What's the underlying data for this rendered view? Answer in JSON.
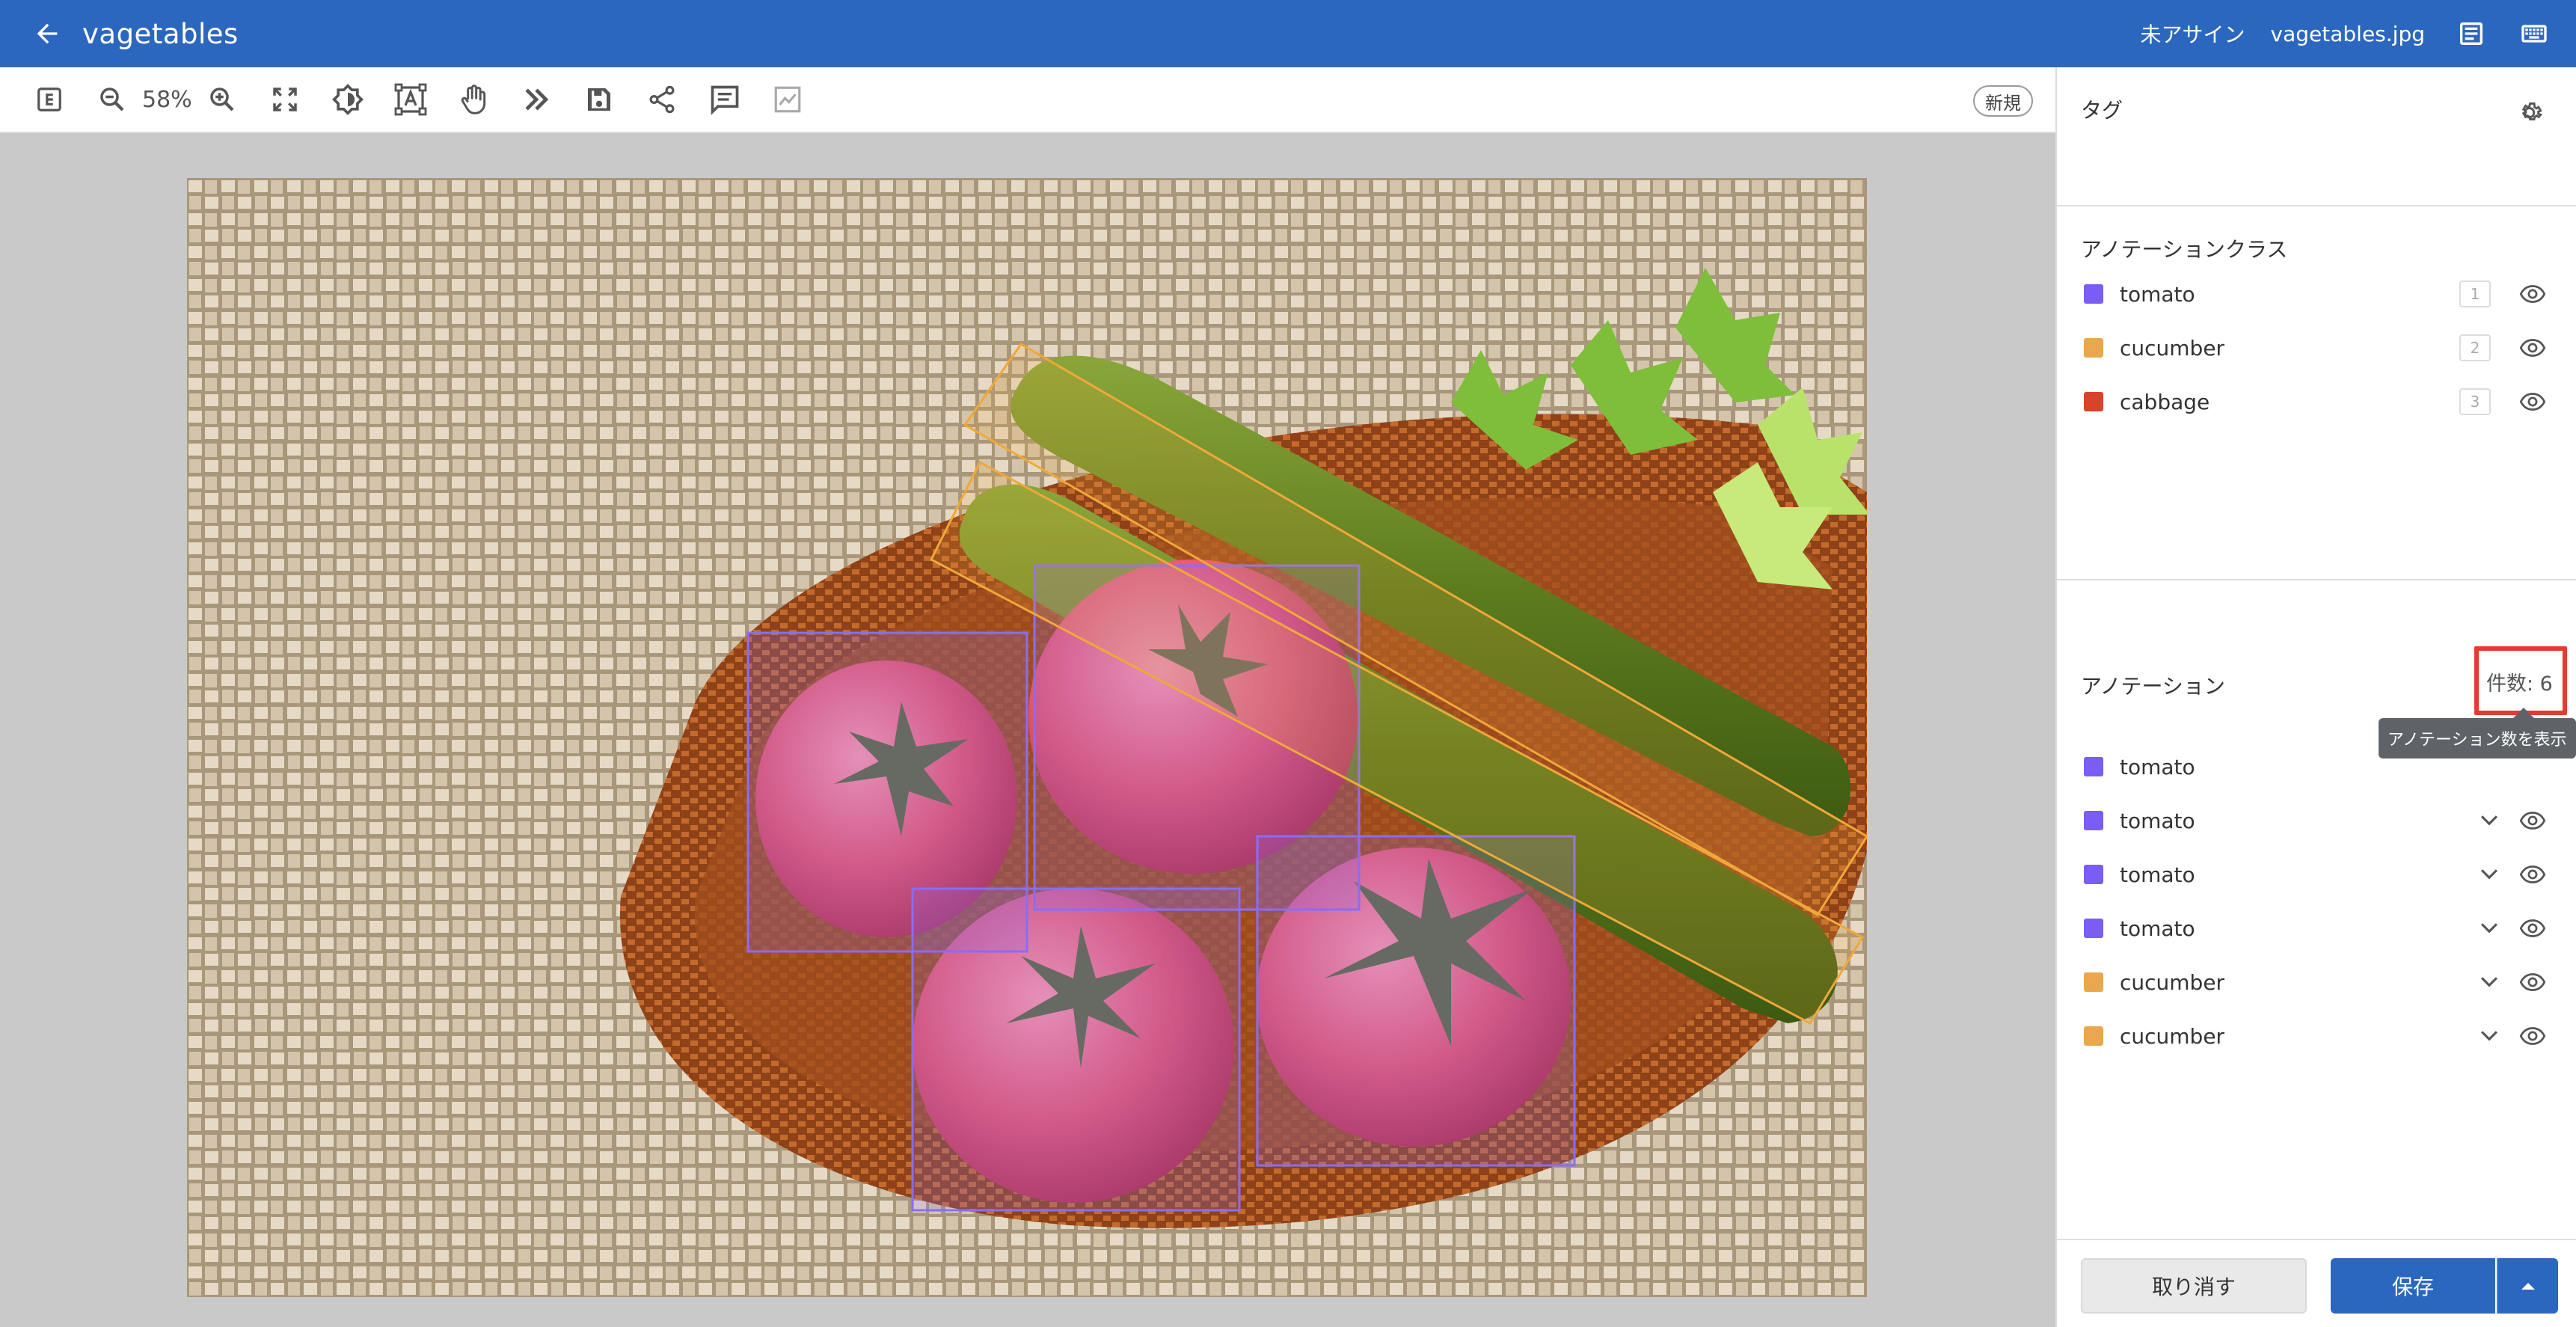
{
  "header": {
    "title": "vagetables",
    "assignee": "未アサイン",
    "filename": "vagetables.jpg",
    "icons": [
      "arrow-left-icon",
      "document-icon",
      "keyboard-icon"
    ]
  },
  "toolbar": {
    "zoom": "58%",
    "new_label": "新規",
    "icons": [
      "e-icon",
      "zoom-out-icon",
      "zoom-in-icon",
      "fit-screen-icon",
      "brightness-icon",
      "text-select-icon",
      "hand-icon",
      "fast-forward-icon",
      "save-icon",
      "share-icon",
      "comment-icon",
      "chart-icon"
    ]
  },
  "canvas": {
    "annotations": [
      {
        "class": "tomato",
        "color": "#8a6cf6"
      },
      {
        "class": "tomato",
        "color": "#8a6cf6"
      },
      {
        "class": "tomato",
        "color": "#8a6cf6"
      },
      {
        "class": "tomato",
        "color": "#8a6cf6"
      },
      {
        "class": "cucumber",
        "color": "#f0a83a"
      },
      {
        "class": "cucumber",
        "color": "#f0a83a"
      }
    ]
  },
  "panel": {
    "tags_title": "タグ",
    "classes_title": "アノテーションクラス",
    "classes": [
      {
        "label": "tomato",
        "key": "1",
        "color": "#7b5cf5"
      },
      {
        "label": "cucumber",
        "key": "2",
        "color": "#e9a84e"
      },
      {
        "label": "cabbage",
        "key": "3",
        "color": "#d9432c"
      }
    ],
    "annotations_title": "アノテーション",
    "count_label": "件数: 6",
    "tooltip": "アノテーション数を表示",
    "annotations": [
      {
        "label": "tomato",
        "color": "#7b5cf5"
      },
      {
        "label": "tomato",
        "color": "#7b5cf5"
      },
      {
        "label": "tomato",
        "color": "#7b5cf5"
      },
      {
        "label": "tomato",
        "color": "#7b5cf5"
      },
      {
        "label": "cucumber",
        "color": "#e9a84e"
      },
      {
        "label": "cucumber",
        "color": "#e9a84e"
      }
    ],
    "highlight_color": "#e53b2f"
  },
  "footer": {
    "cancel": "取り消す",
    "save": "保存"
  }
}
